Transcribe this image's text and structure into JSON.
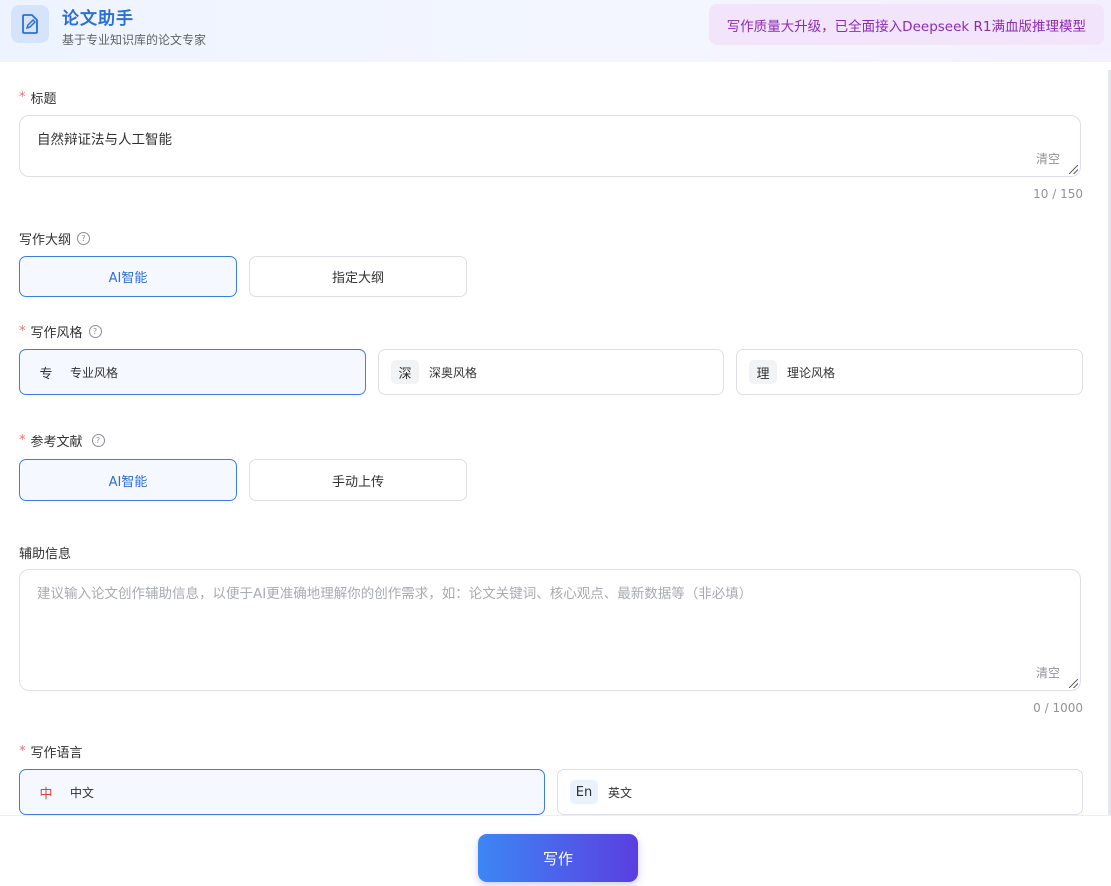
{
  "header": {
    "title": "论文助手",
    "subtitle": "基于专业知识库的论文专家",
    "promo": "写作质量大升级，已全面接入Deepseek R1满血版推理模型",
    "logo_icon": "document-edit-icon"
  },
  "title_field": {
    "label": "标题",
    "required_mark": "*",
    "value": "自然辩证法与人工智能",
    "clear": "清空",
    "counter": "10 / 150"
  },
  "outline": {
    "label": "写作大纲",
    "help": "?",
    "options": [
      "AI智能",
      "指定大纲"
    ],
    "selected": "AI智能"
  },
  "style": {
    "label": "写作风格",
    "required_mark": "*",
    "help": "?",
    "options": [
      {
        "badge": "专",
        "label": "专业风格"
      },
      {
        "badge": "深",
        "label": "深奥风格"
      },
      {
        "badge": "理",
        "label": "理论风格"
      }
    ],
    "selected": "专业风格"
  },
  "references": {
    "label": "参考文献",
    "required_mark": "*",
    "help": "?",
    "options": [
      "AI智能",
      "手动上传"
    ],
    "selected": "AI智能"
  },
  "aux": {
    "label": "辅助信息",
    "placeholder": "建议输入论文创作辅助信息，以便于AI更准确地理解你的创作需求，如：论文关键词、核心观点、最新数据等（非必填）",
    "clear": "清空",
    "counter": "0 / 1000"
  },
  "language": {
    "label": "写作语言",
    "required_mark": "*",
    "options": [
      {
        "badge": "中",
        "label": "中文"
      },
      {
        "badge": "En",
        "label": "英文"
      }
    ],
    "selected": "中文"
  },
  "footer": {
    "write_label": "写作"
  },
  "colors": {
    "accent": "#3d7fdc",
    "required": "#f56c6c",
    "promo_text": "#8e2bb3",
    "button_gradient_start": "#3d86f5",
    "button_gradient_end": "#5a3fe0"
  }
}
